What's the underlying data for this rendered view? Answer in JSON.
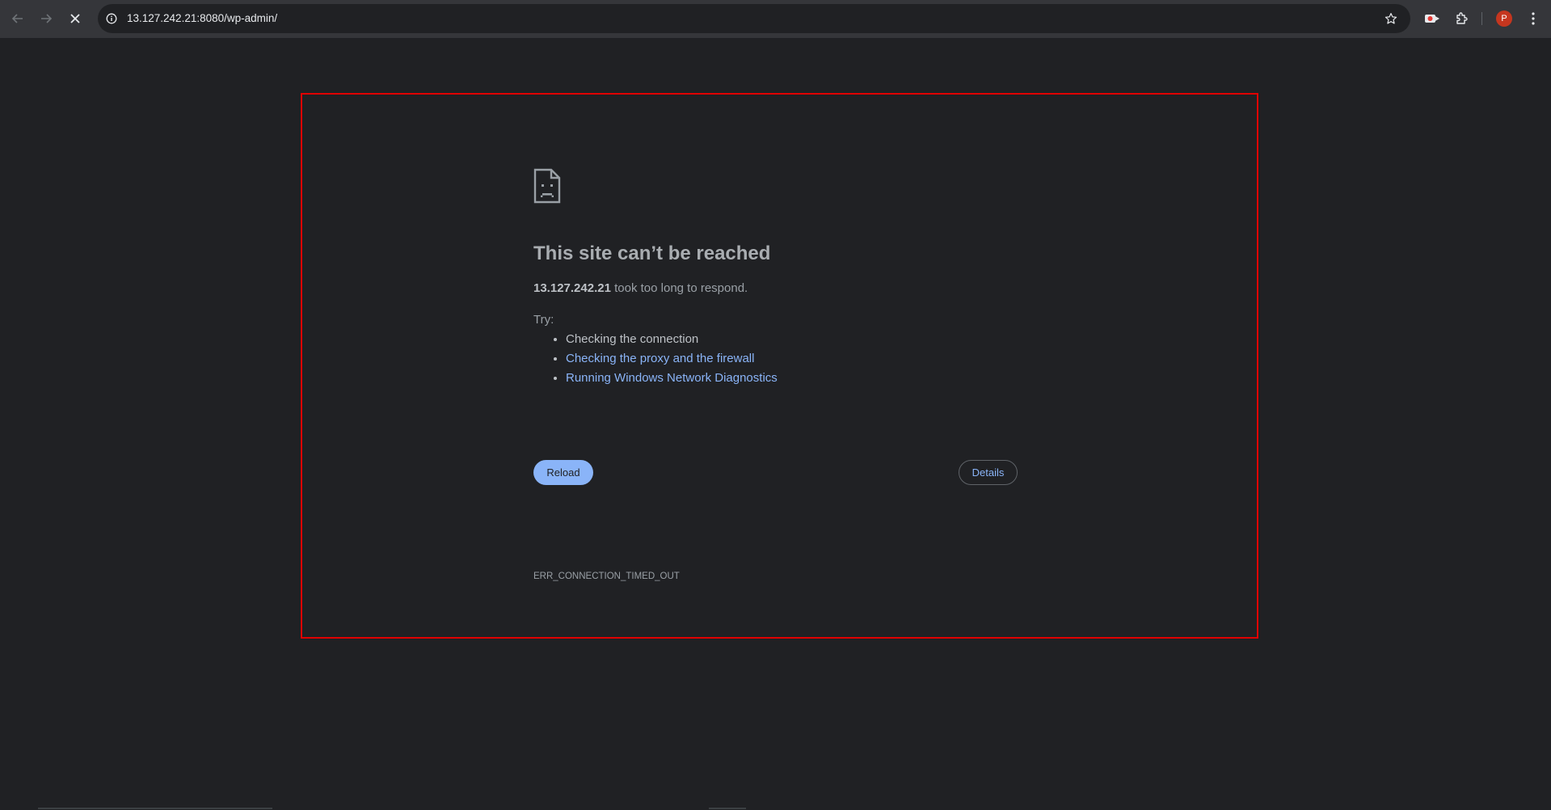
{
  "browser": {
    "url": "13.127.242.21:8080/wp-admin/",
    "profile_initial": "P"
  },
  "error": {
    "title": "This site can’t be reached",
    "host": "13.127.242.21",
    "message": " took too long to respond.",
    "try_label": "Try:",
    "suggestions": [
      {
        "text": "Checking the connection",
        "link": false
      },
      {
        "text": "Checking the proxy and the firewall",
        "link": true
      },
      {
        "text": "Running Windows Network Diagnostics",
        "link": true
      }
    ],
    "code": "ERR_CONNECTION_TIMED_OUT",
    "reload_label": "Reload",
    "details_label": "Details"
  },
  "colors": {
    "page_bg": "#202124",
    "toolbar_bg": "#35363a",
    "link": "#8ab4f8",
    "highlight_border": "#e00000"
  }
}
